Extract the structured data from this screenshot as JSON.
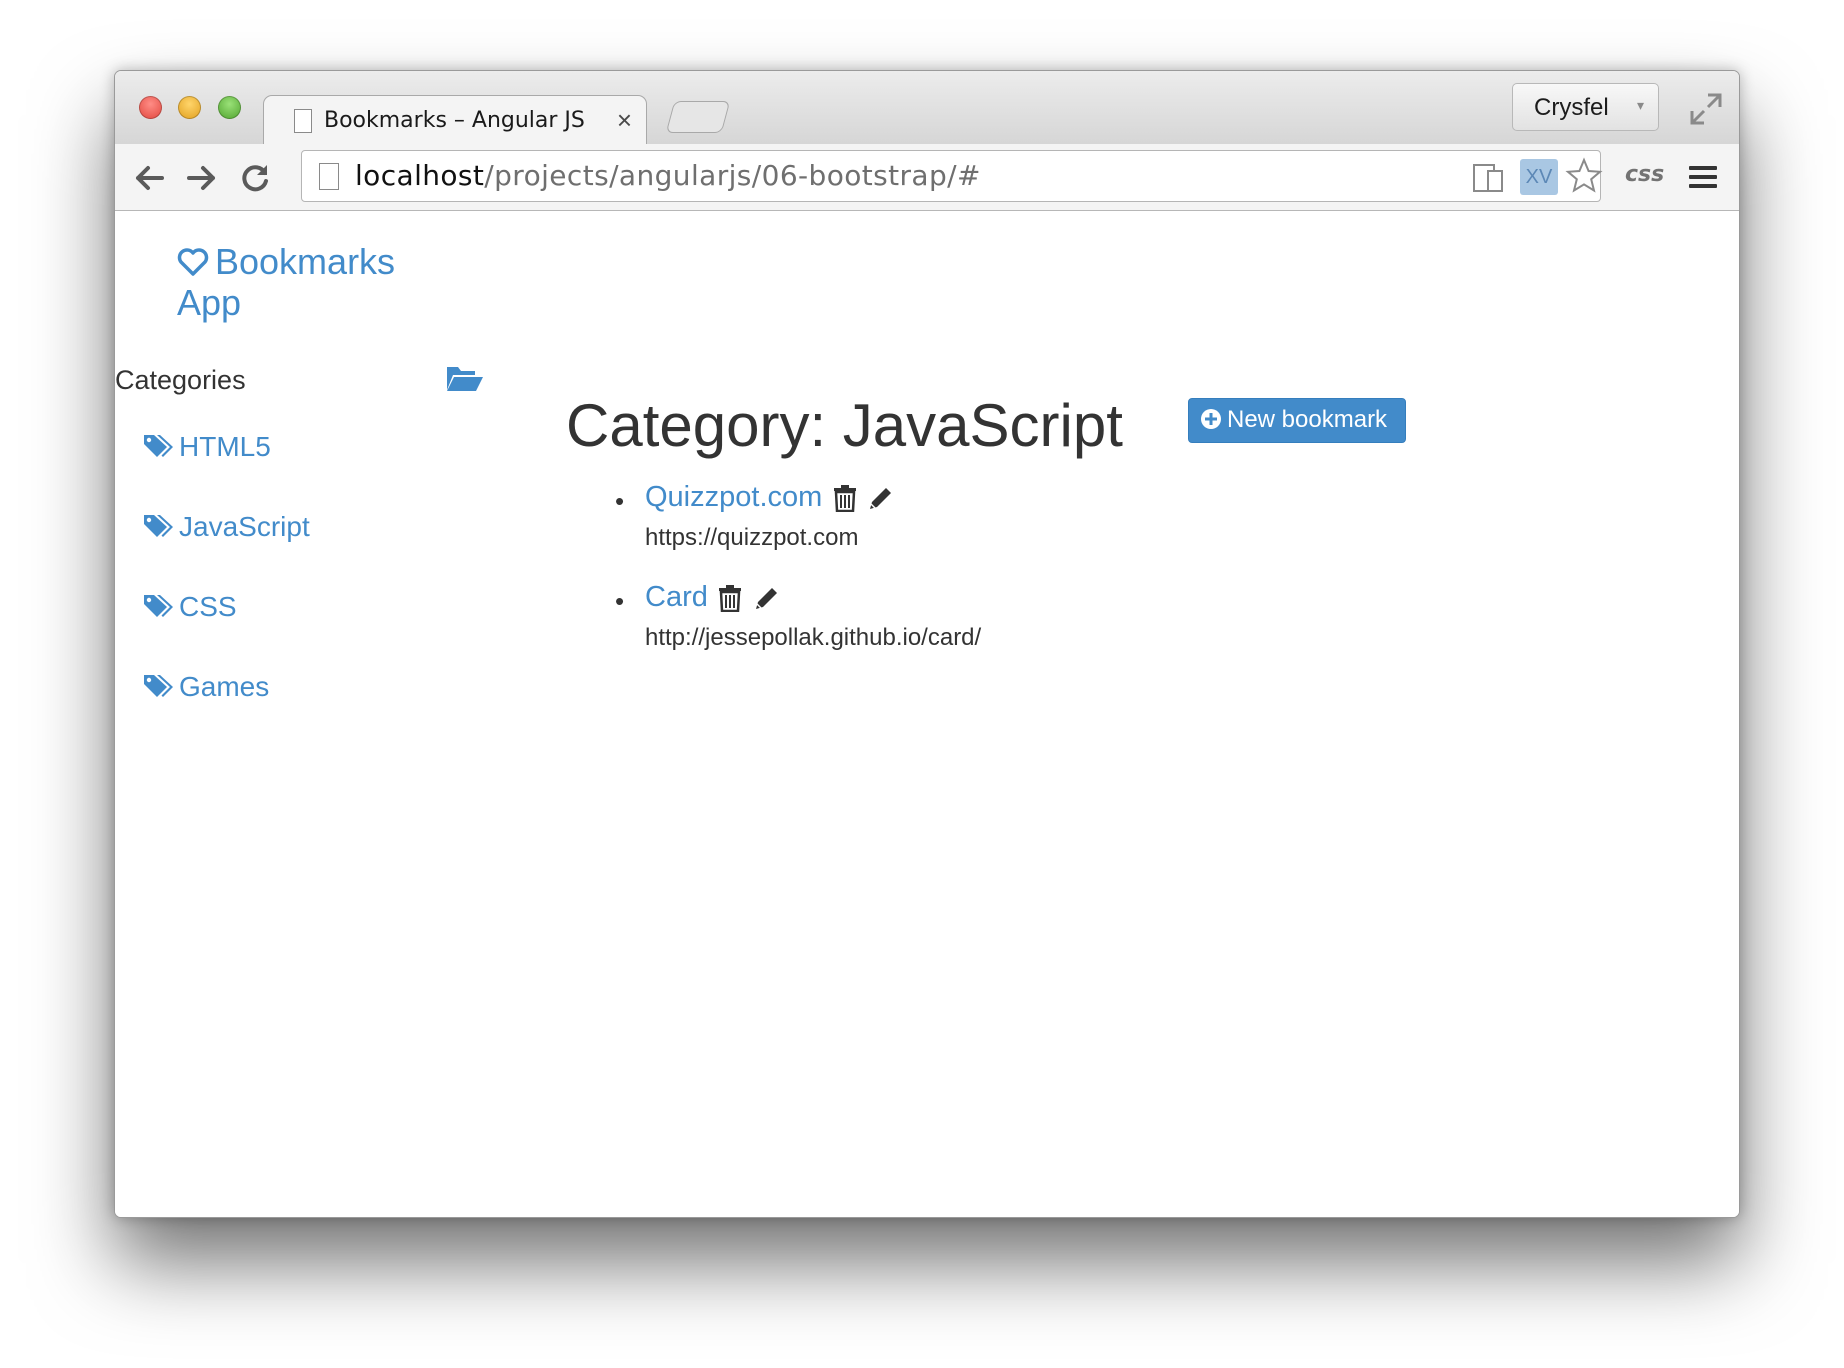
{
  "browser": {
    "tab_title": "Bookmarks – Angular JS",
    "tab_close": "×",
    "profile_name": "Crysfel",
    "profile_caret": "▾",
    "url_host": "localhost",
    "url_path": "/projects/angularjs/06-bootstrap/#",
    "xv_extension_label": "XV",
    "css_extension_label": "css"
  },
  "app": {
    "brand_line1": "Bookmarks",
    "brand_line2": "App",
    "categories_label": "Categories",
    "categories": [
      {
        "name": "HTML5"
      },
      {
        "name": "JavaScript"
      },
      {
        "name": "CSS"
      },
      {
        "name": "Games"
      }
    ],
    "heading": "Category: JavaScript",
    "new_bookmark_label": "New bookmark",
    "bookmarks": [
      {
        "title": "Quizzpot.com",
        "url": "https://quizzpot.com"
      },
      {
        "title": "Card",
        "url": "http://jessepollak.github.io/card/"
      }
    ]
  },
  "icons": {
    "nav": [
      "back-arrow-icon",
      "forward-arrow-icon",
      "reload-icon"
    ],
    "omnibox": [
      "page-icon",
      "devices-icon",
      "star-icon"
    ],
    "app": [
      "heart-icon",
      "folder-open-icon",
      "tag-icon",
      "plus-circle-icon",
      "trash-icon",
      "pencil-icon"
    ]
  },
  "colors": {
    "link": "#428bca",
    "button_bg": "#428bca",
    "text": "#333333"
  }
}
